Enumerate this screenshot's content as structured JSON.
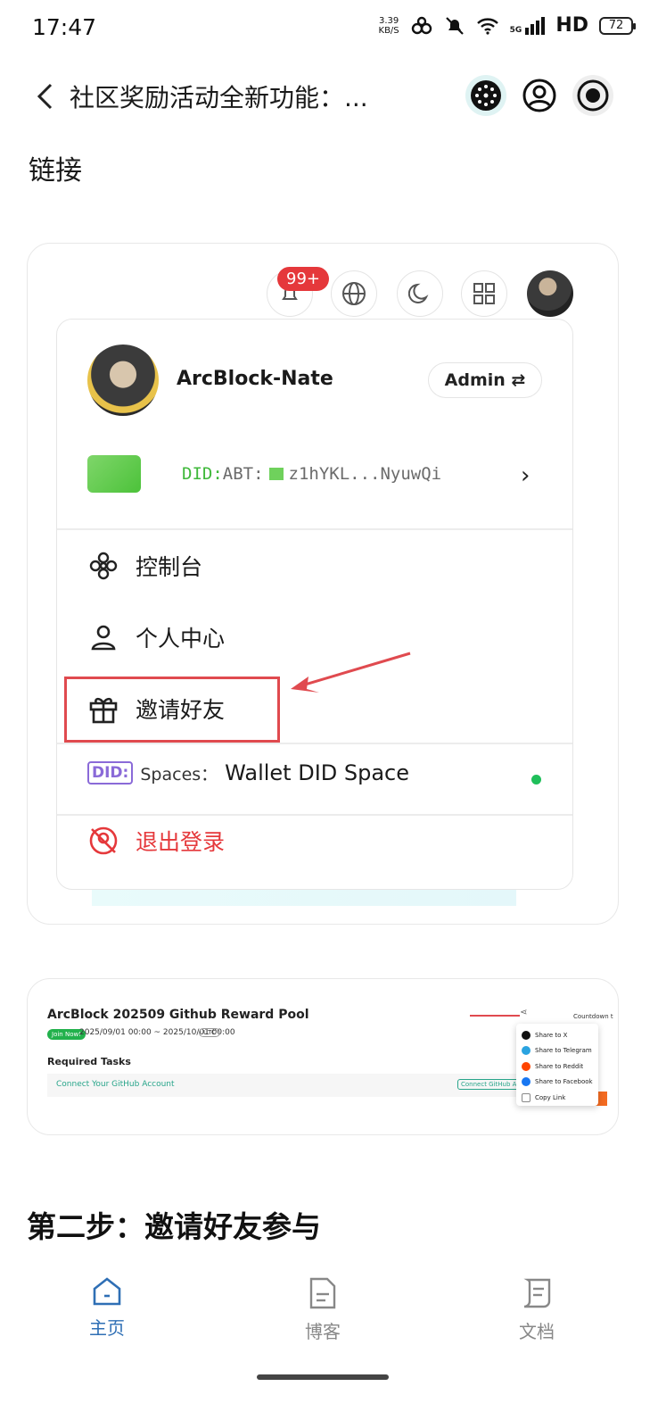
{
  "status_bar": {
    "time": "17:47",
    "net_speed_value": "3.39",
    "net_speed_unit": "KB/S",
    "network_type": "5G",
    "hd_label": "HD",
    "battery": "72"
  },
  "header": {
    "title": "社区奖励活动全新功能：...",
    "icons": [
      "back-arrow-icon",
      "app-logo-icon",
      "user-icon",
      "record-icon"
    ]
  },
  "content": {
    "link_text": "链接",
    "section_title": "第二步：邀请好友参与"
  },
  "screenshot_card_1": {
    "notification_badge": "99+",
    "user": {
      "name": "ArcBlock-Nate",
      "role_button": "Admin ⇄"
    },
    "did": {
      "prefix": "DID:",
      "type": "ABT:",
      "value": "z1hYKL...NyuwQi"
    },
    "menu_items": [
      {
        "label": "控制台",
        "icon": "dashboard-icon"
      },
      {
        "label": "个人中心",
        "icon": "user-icon"
      },
      {
        "label": "邀请好友",
        "icon": "gift-icon"
      }
    ],
    "spaces": {
      "tag": "DID:",
      "label": "Spaces：",
      "value": "Wallet DID Space"
    },
    "logout": "退出登录",
    "colors": {
      "highlight": "#e04a4f",
      "logout": "#e5383b",
      "status_dot": "#1fbf5a"
    }
  },
  "screenshot_card_2": {
    "title": "ArcBlock 202509 Github Reward Pool",
    "join_badge": "Join Now!",
    "date_range": "2025/09/01 00:00 ~ 2025/10/01 00:00",
    "timezone": "UTC",
    "required_tasks": "Required Tasks",
    "task": "Connect Your GitHub Account",
    "task_button": "Connect GitHub Account",
    "countdown": "Countdown t",
    "share_menu": [
      {
        "label": "Share to X",
        "color": "#111111"
      },
      {
        "label": "Share to Telegram",
        "color": "#2aa3e0"
      },
      {
        "label": "Share to Reddit",
        "color": "#ff4500"
      },
      {
        "label": "Share to Facebook",
        "color": "#1877f2"
      },
      {
        "label": "Copy Link",
        "color": "#888888"
      }
    ]
  },
  "bottom_nav": {
    "items": [
      {
        "label": "主页",
        "icon": "home-icon",
        "active": true
      },
      {
        "label": "博客",
        "icon": "blog-icon",
        "active": false
      },
      {
        "label": "文档",
        "icon": "docs-icon",
        "active": false
      }
    ],
    "active_color": "#2f6fb5",
    "inactive_color": "#888888"
  }
}
